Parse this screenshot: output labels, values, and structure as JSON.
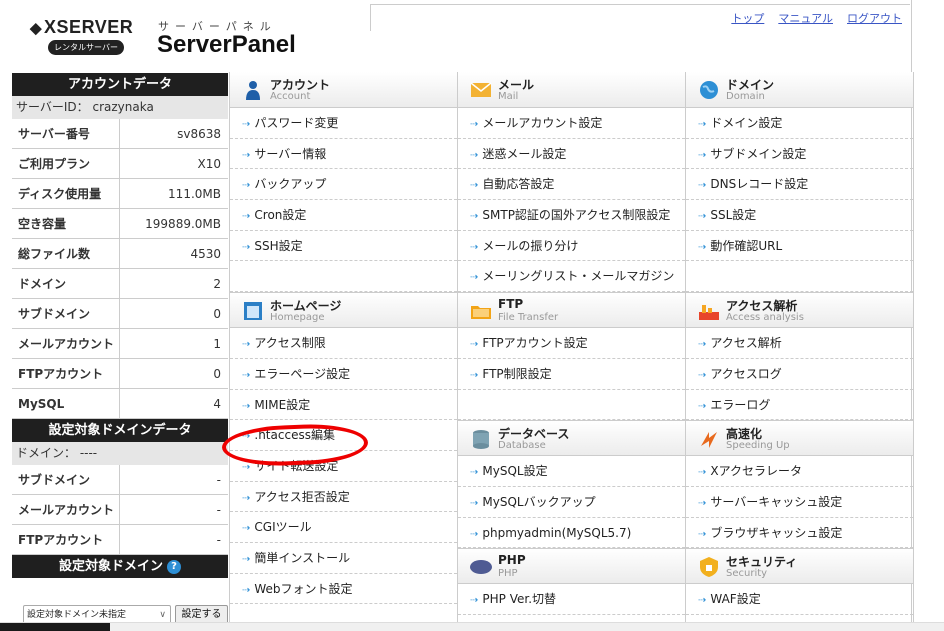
{
  "header": {
    "logo_brand": "XSERVER",
    "logo_rental": "レンタルサーバー",
    "logo_kana": "サーバーパネル",
    "logo_title": "ServerPanel",
    "links": [
      "トップ",
      "マニュアル",
      "ログアウト"
    ]
  },
  "sidebar": {
    "account_title": "アカウントデータ",
    "server_id": "サーバーID： crazynaka",
    "rows": [
      {
        "label": "サーバー番号",
        "value": "sv8638"
      },
      {
        "label": "ご利用プラン",
        "value": "X10"
      },
      {
        "label": "ディスク使用量",
        "value": "111.0MB"
      },
      {
        "label": "空き容量",
        "value": "199889.0MB"
      },
      {
        "label": "総ファイル数",
        "value": "4530"
      },
      {
        "label": "ドメイン",
        "value": "2"
      },
      {
        "label": "サブドメイン",
        "value": "0"
      },
      {
        "label": "メールアカウント",
        "value": "1"
      },
      {
        "label": "FTPアカウント",
        "value": "0"
      },
      {
        "label": "MySQL",
        "value": "4"
      }
    ],
    "domain_title": "設定対象ドメインデータ",
    "domain_line": "ドメイン： ----",
    "domain_rows": [
      {
        "label": "サブドメイン",
        "value": "-"
      },
      {
        "label": "メールアカウント",
        "value": "-"
      },
      {
        "label": "FTPアカウント",
        "value": "-"
      }
    ],
    "target_title": "設定対象ドメイン",
    "help": "?",
    "select_value": "設定対象ドメイン未指定",
    "set_button": "設定する"
  },
  "sections": {
    "account": {
      "jp": "アカウント",
      "en": "Account",
      "items": [
        "パスワード変更",
        "サーバー情報",
        "バックアップ",
        "Cron設定",
        "SSH設定"
      ]
    },
    "mail": {
      "jp": "メール",
      "en": "Mail",
      "items": [
        "メールアカウント設定",
        "迷惑メール設定",
        "自動応答設定",
        "SMTP認証の国外アクセス制限設定",
        "メールの振り分け",
        "メーリングリスト・メールマガジン"
      ]
    },
    "domain": {
      "jp": "ドメイン",
      "en": "Domain",
      "items": [
        "ドメイン設定",
        "サブドメイン設定",
        "DNSレコード設定",
        "SSL設定",
        "動作確認URL"
      ]
    },
    "homepage": {
      "jp": "ホームページ",
      "en": "Homepage",
      "items": [
        "アクセス制限",
        "エラーページ設定",
        "MIME設定",
        ".htaccess編集",
        "サイト転送設定",
        "アクセス拒否設定",
        "CGIツール",
        "簡単インストール",
        "Webフォント設定"
      ]
    },
    "ftp": {
      "jp": "FTP",
      "en": "File Transfer",
      "items": [
        "FTPアカウント設定",
        "FTP制限設定"
      ]
    },
    "access": {
      "jp": "アクセス解析",
      "en": "Access analysis",
      "items": [
        "アクセス解析",
        "アクセスログ",
        "エラーログ"
      ]
    },
    "database": {
      "jp": "データベース",
      "en": "Database",
      "items": [
        "MySQL設定",
        "MySQLバックアップ",
        "phpmyadmin(MySQL5.7)"
      ]
    },
    "speed": {
      "jp": "高速化",
      "en": "Speeding Up",
      "items": [
        "Xアクセラレータ",
        "サーバーキャッシュ設定",
        "ブラウザキャッシュ設定"
      ]
    },
    "php": {
      "jp": "PHP",
      "en": "PHP",
      "items": [
        "PHP Ver.切替"
      ]
    },
    "security": {
      "jp": "セキュリティ",
      "en": "Security",
      "items": [
        "WAF設定"
      ]
    }
  },
  "colors": {
    "accent": "#2d8fd5",
    "link": "#3a56c5",
    "highlight": "#e00000",
    "sidebar_head": "#1f1f1f"
  }
}
